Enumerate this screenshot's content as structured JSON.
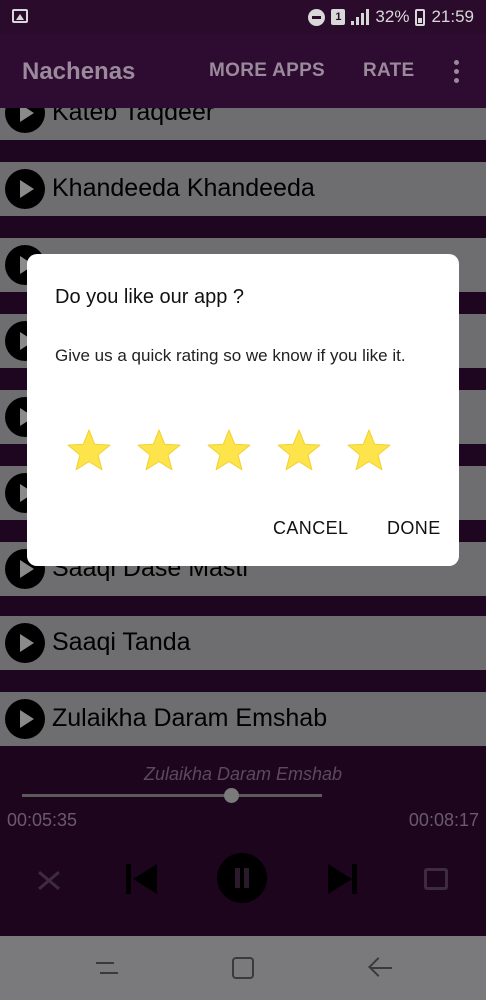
{
  "status_bar": {
    "sim_label": "1",
    "battery": "32%",
    "time": "21:59"
  },
  "app_bar": {
    "title": "Nachenas",
    "more_apps": "MORE APPS",
    "rate": "RATE"
  },
  "songs": [
    "Kateb Taqdeer",
    "Khandeeda Khandeeda",
    "",
    "",
    "",
    "",
    "Saaqi Dase Masti",
    "Saaqi Tanda",
    "Zulaikha Daram Emshab"
  ],
  "player": {
    "now_playing": "Zulaikha Daram Emshab",
    "elapsed": "00:05:35",
    "duration": "00:08:17",
    "progress_fraction": 0.674
  },
  "dialog": {
    "title": "Do you like our app ?",
    "message": "Give us a quick rating so we know if you like it.",
    "stars_total": 5,
    "stars_filled": 5,
    "star_color": "#fce44a",
    "cancel": "CANCEL",
    "done": "DONE"
  },
  "colors": {
    "app_bar": "#2e0b30",
    "row": "#6e6e70",
    "divider": "#1f0620"
  }
}
